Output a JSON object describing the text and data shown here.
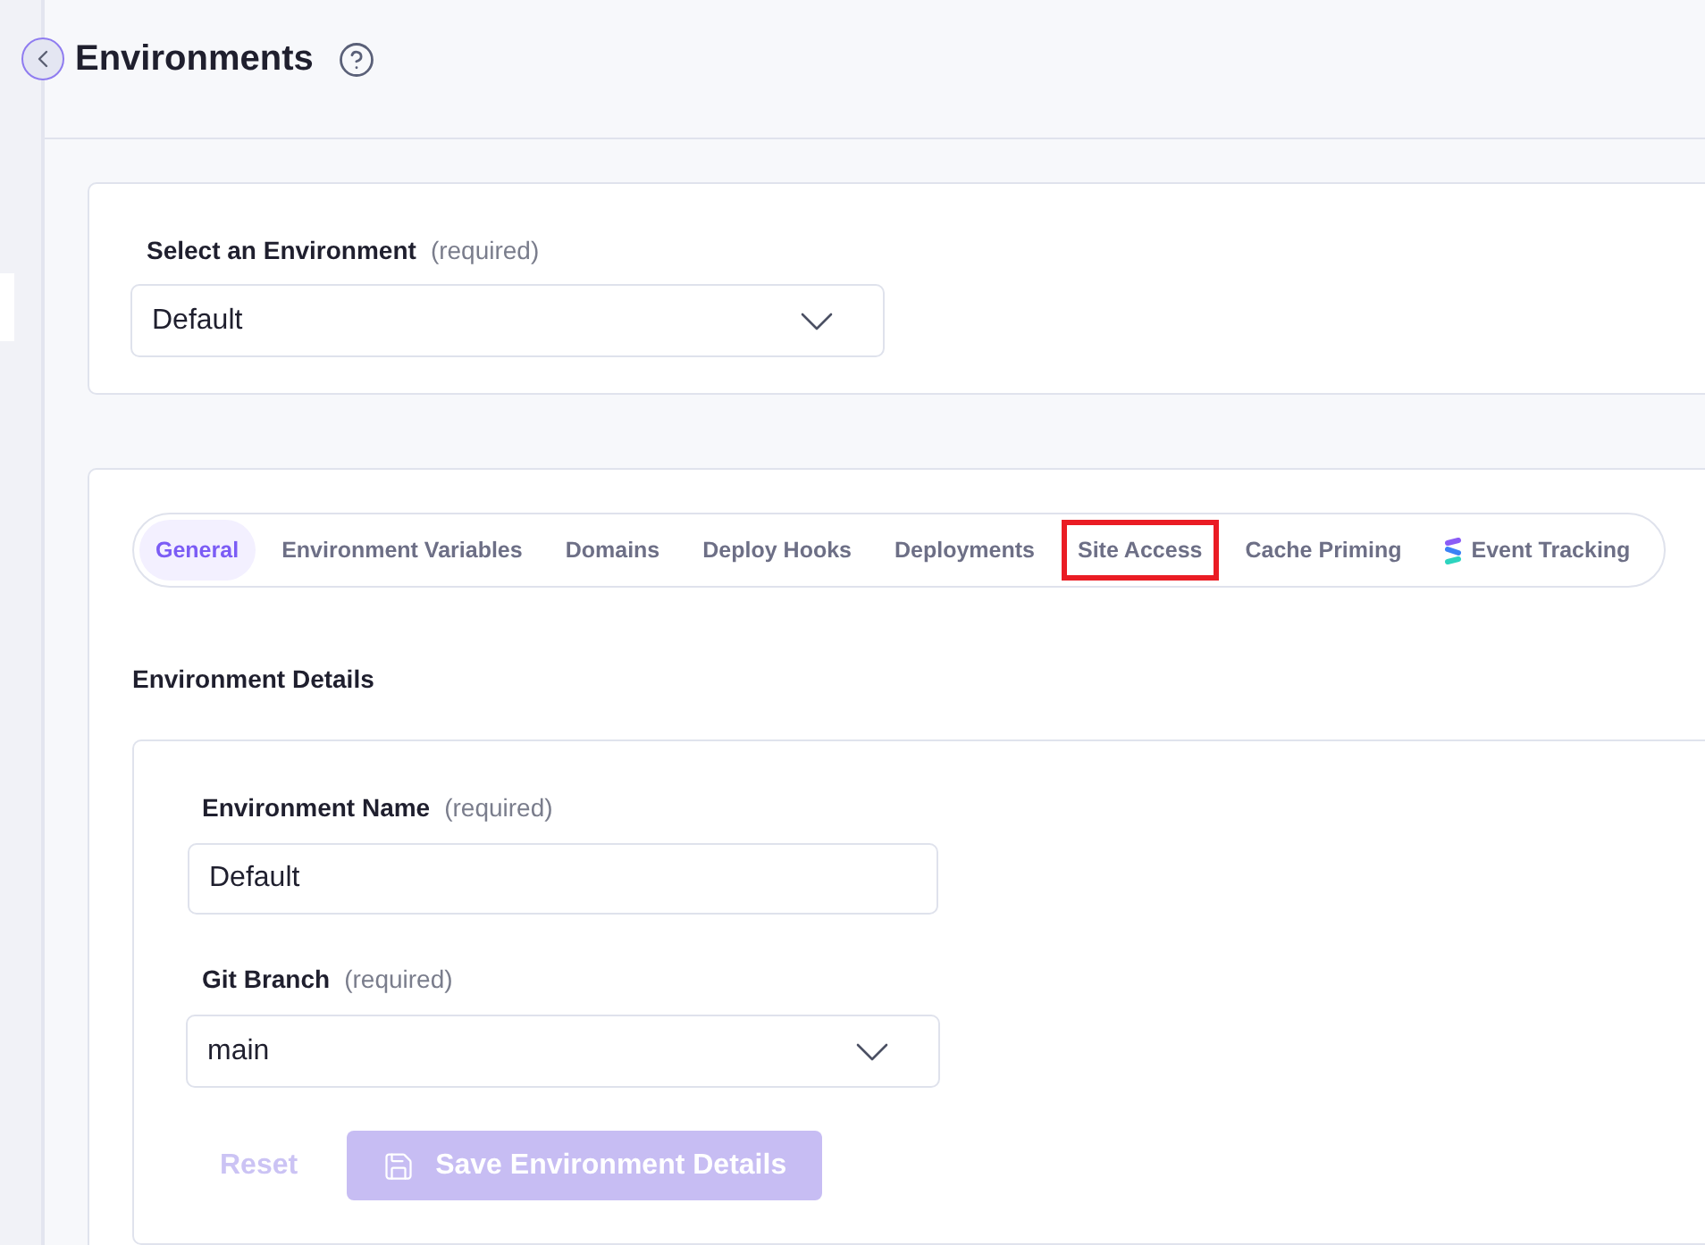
{
  "header": {
    "title": "Environments"
  },
  "environment_select": {
    "label": "Select an Environment",
    "hint": "(required)",
    "value": "Default"
  },
  "tabs": [
    {
      "label": "General",
      "kind": "text",
      "selected": true,
      "highlighted": false
    },
    {
      "label": "Environment Variables",
      "kind": "text",
      "selected": false,
      "highlighted": false
    },
    {
      "label": "Domains",
      "kind": "text",
      "selected": false,
      "highlighted": false
    },
    {
      "label": "Deploy Hooks",
      "kind": "text",
      "selected": false,
      "highlighted": false
    },
    {
      "label": "Deployments",
      "kind": "text",
      "selected": false,
      "highlighted": false
    },
    {
      "label": "Site Access",
      "kind": "text",
      "selected": false,
      "highlighted": true
    },
    {
      "label": "Cache Priming",
      "kind": "text",
      "selected": false,
      "highlighted": false
    },
    {
      "label": "Event Tracking",
      "kind": "with-icon",
      "selected": false,
      "highlighted": false
    }
  ],
  "details": {
    "heading": "Environment Details",
    "fields": [
      {
        "kind": "text",
        "label": "Environment Name",
        "hint": "(required)",
        "value": "Default"
      },
      {
        "kind": "select",
        "label": "Git Branch",
        "hint": "(required)",
        "value": "main"
      }
    ],
    "buttons": [
      {
        "kind": "link",
        "label": "Reset",
        "disabled": true
      },
      {
        "kind": "primary",
        "label": "Save Environment Details",
        "disabled": true
      }
    ]
  }
}
